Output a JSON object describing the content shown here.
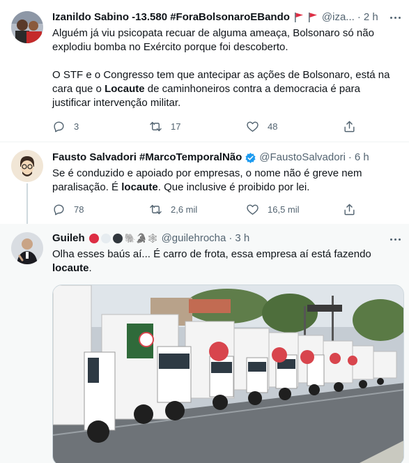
{
  "tweets": [
    {
      "name": "Izanildo Sabino -13.580 #ForaBolsonaroEBando",
      "name_emoji": "🚩🚩",
      "handle": "@iza...",
      "time": "2 h",
      "text_p1": "Alguém já viu psicopata recuar de alguma ameaça, Bolsonaro só não explodiu bomba no Exército porque foi descoberto.",
      "text_p2_before": "O STF e o Congresso tem que antecipar as ações de Bolsonaro, está na cara que o ",
      "text_p2_bold": "Locaute",
      "text_p2_after": " de caminhoneiros contra a democracia é para justificar intervenção militar.",
      "replies": "3",
      "retweets": "17",
      "likes": "48"
    },
    {
      "name": "Fausto Salvadori #MarcoTemporalNão",
      "handle": "@FaustoSalvadori",
      "time": "6 h",
      "text_before": "Se é conduzido e apoiado por empresas, o nome não é greve nem paralisação. É ",
      "text_bold": "locaute",
      "text_after": ". Que inclusive é proibido por lei.",
      "replies": "78",
      "retweets": "2,6 mil",
      "likes": "16,5 mil"
    },
    {
      "name": "Guileh",
      "name_emoji": "🐘🐊🕸",
      "handle": "@guilehrocha",
      "time": "3 h",
      "text_before": "Olha esses baús aí... É carro de frota, essa empresa aí está fazendo ",
      "text_bold": "locaute",
      "text_after": "."
    }
  ],
  "colors": {
    "text": "#0f1419",
    "secondary": "#536471",
    "verified": "#1d9bf0",
    "red_flag": "#e0245e"
  },
  "icons": [
    "more-icon",
    "reply-icon",
    "retweet-icon",
    "like-icon",
    "share-icon",
    "verified-icon",
    "red-flag-icon"
  ]
}
